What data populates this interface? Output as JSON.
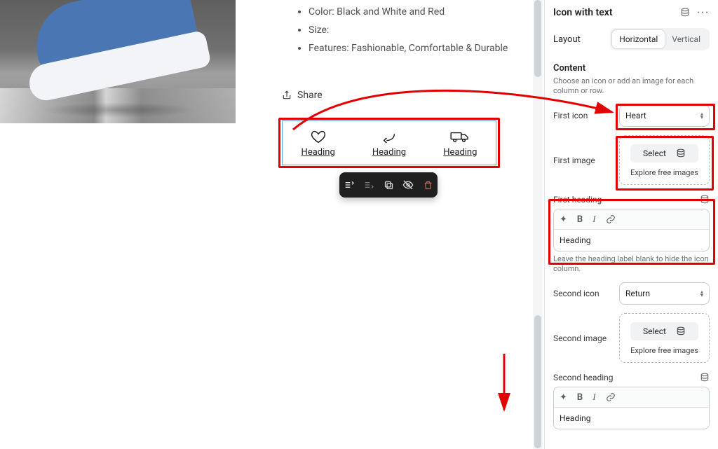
{
  "product": {
    "bullets": [
      "Color: Black and White and Red",
      "Size:",
      "Features: Fashionable, Comfortable & Durable"
    ],
    "share_label": "Share"
  },
  "icon_block": {
    "columns": [
      {
        "icon": "heart-icon",
        "heading": "Heading"
      },
      {
        "icon": "return-icon",
        "heading": "Heading"
      },
      {
        "icon": "truck-icon",
        "heading": "Heading"
      }
    ]
  },
  "float_tb": {
    "items": [
      "move-icon",
      "route-icon",
      "duplicate-icon",
      "hide-icon",
      "delete-icon"
    ]
  },
  "panel": {
    "title": "Icon with text",
    "layout_label": "Layout",
    "layout_options": {
      "a": "Horizontal",
      "b": "Vertical",
      "active": "a"
    },
    "content_heading": "Content",
    "content_help": "Choose an icon or add an image for each column or row.",
    "first_icon_label": "First icon",
    "first_icon_value": "Heart",
    "first_image_label": "First image",
    "select_btn": "Select",
    "explore_label": "Explore free images",
    "first_heading_label": "First heading",
    "first_heading_value": "Heading",
    "first_heading_help": "Leave the heading label blank to hide the icon column.",
    "second_icon_label": "Second icon",
    "second_icon_value": "Return",
    "second_image_label": "Second image",
    "second_heading_label": "Second heading",
    "second_heading_value": "Heading"
  }
}
